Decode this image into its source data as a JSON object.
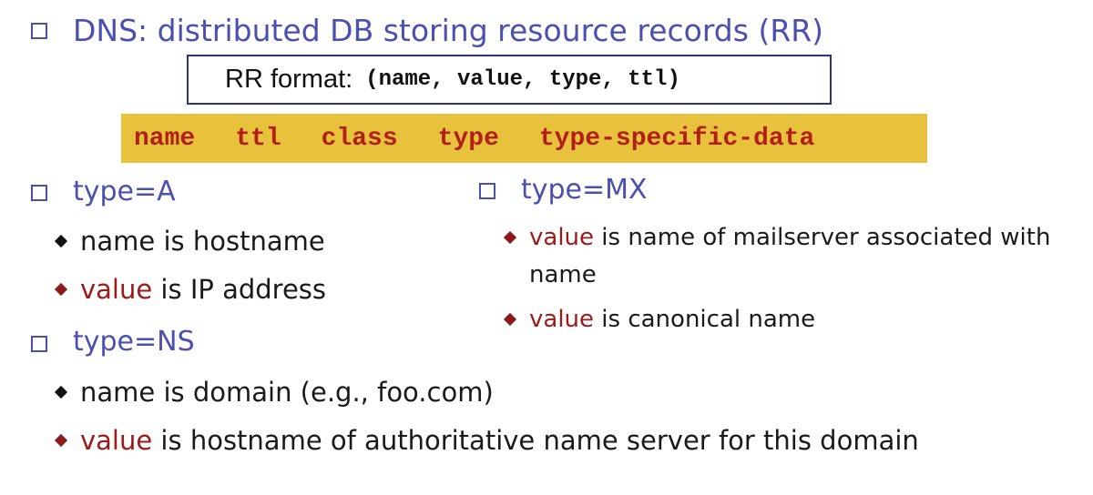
{
  "heading": "DNS: distributed DB storing resource records (RR)",
  "rr_box": {
    "label": "RR format:",
    "fields": "(name, value, type, ttl)"
  },
  "record_fields": [
    "name",
    "ttl",
    "class",
    "type",
    "type-specific-data"
  ],
  "type_a": {
    "title": "type=A",
    "bullets": [
      {
        "keyword": "",
        "text": "name is hostname"
      },
      {
        "keyword": "value",
        "text": " is IP address"
      }
    ]
  },
  "type_ns": {
    "title": "type=NS",
    "bullets": [
      {
        "keyword": "",
        "text": "name is domain (e.g., foo.com)"
      },
      {
        "keyword": "value",
        "text": " is hostname of authoritative name server for this domain"
      }
    ]
  },
  "type_mx": {
    "title": "type=MX",
    "bullets": [
      {
        "keyword": "value",
        "text": " is name of mailserver associated with",
        "continuation": "name"
      },
      {
        "keyword": "value",
        "text": " is canonical name"
      }
    ]
  },
  "colors": {
    "heading_blue": "#4a4fb0",
    "keyword_red": "#9b1a1a",
    "field_red": "#b21f16",
    "field_bar": "#e8c13d",
    "box_border": "#2a3580"
  }
}
